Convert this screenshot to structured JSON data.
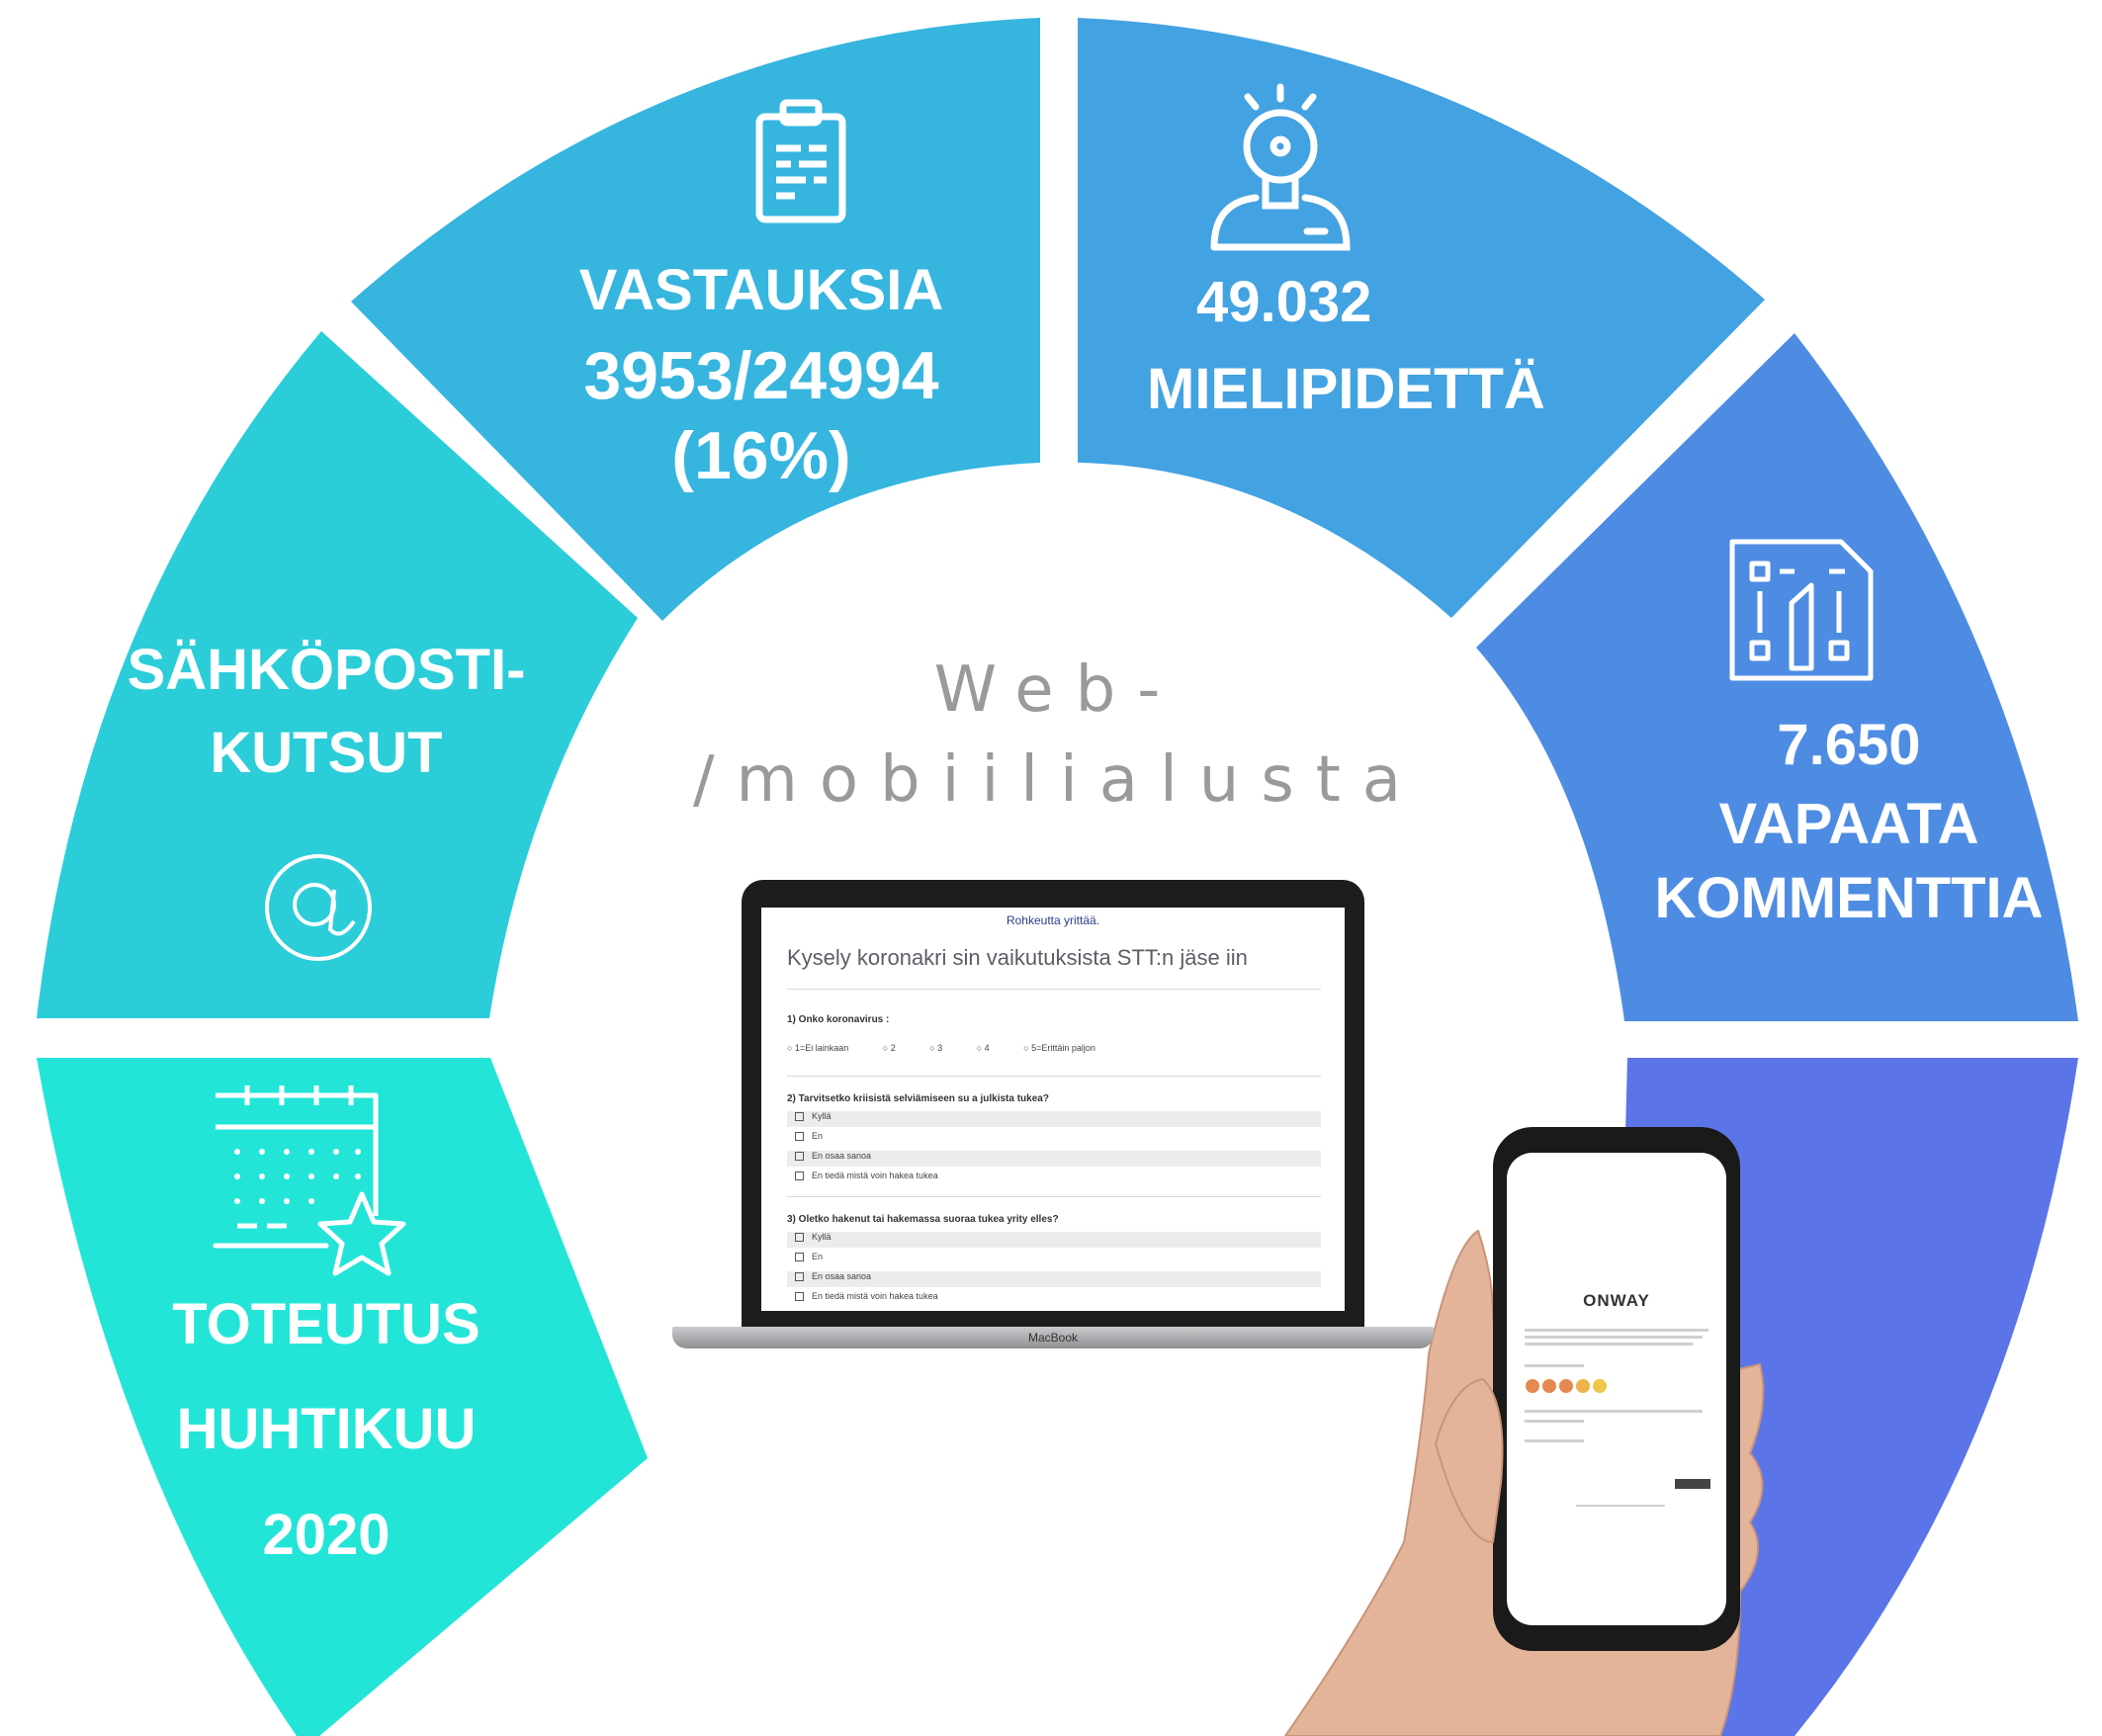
{
  "segments": {
    "vastauksia": {
      "lines": [
        "VASTAUKSIA",
        "3953/24994",
        "(16%)"
      ],
      "color": "#36B5DF",
      "icon": "clipboard-icon"
    },
    "mielipidetta": {
      "lines": [
        "49.032",
        "MIELIPIDETTÄ"
      ],
      "color": "#43A2E1",
      "icon": "lightbulb-person-icon"
    },
    "vapaata": {
      "lines": [
        "7.650",
        "VAPAATA",
        "KOMMENTTIA"
      ],
      "color": "#4E8CE3",
      "icon": "design-document-icon"
    },
    "sahkoposti": {
      "lines": [
        "SÄHKÖPOSTI-",
        "KUTSUT"
      ],
      "color": "#2BCDD9",
      "icon": "at-sign-icon"
    },
    "toteutus": {
      "lines": [
        "TOTEUTUS",
        "HUHTIKUU",
        "2020"
      ],
      "color": "#22E5D8",
      "icon": "calendar-star-icon"
    },
    "device": {
      "color": "#5B74E8"
    }
  },
  "center": {
    "lines": [
      "Web-",
      "/mobiilialusta"
    ]
  },
  "laptop": {
    "brand": "MacBook",
    "tagline": "Rohkeutta yrittää.",
    "heading": "Kysely koronakri  sin vaikutuksista STT:n jäse  iin",
    "q1": "1) Onko koronavirus :",
    "scale": [
      "1=Ei lainkaan",
      "2",
      "3",
      "4",
      "5=Erittäin paljon"
    ],
    "q2": "2) Tarvitsetko kriisistä selviämiseen su   a julkista tukea?",
    "q2_options": [
      "Kyllä",
      "En",
      "En osaa sanoa",
      "En tiedä mistä voin hakea tukea"
    ],
    "q3": "3) Oletko hakenut tai hakemassa suoraa tukea yrity   elles?",
    "q3_options": [
      "Kyllä",
      "En",
      "En osaa sanoa",
      "En tiedä mistä voin hakea tukea"
    ]
  },
  "phone": {
    "brand": "ONWAY"
  }
}
